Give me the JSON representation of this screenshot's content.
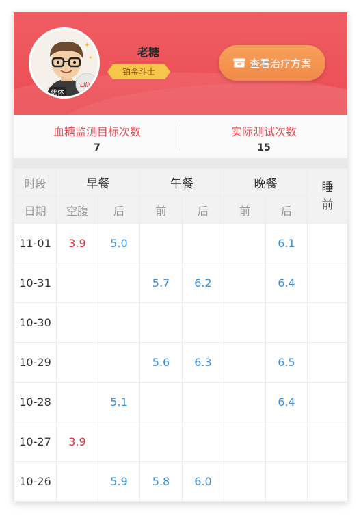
{
  "header": {
    "user_name": "老糖",
    "level": "铂金斗士",
    "avatar_tag": "优体",
    "plan_button_label": "查看治疗方案",
    "colors": {
      "header_bg": "#ec4c53",
      "button_bg": "#f08948",
      "badge_bg": "#f6c64a"
    },
    "icons": {
      "plan_button": "box-icon"
    }
  },
  "stats": {
    "target_label": "血糖监测目标次数",
    "target_value": "7",
    "actual_label": "实际测试次数",
    "actual_value": "15"
  },
  "table": {
    "row_header": {
      "period": "时段",
      "date": "日期"
    },
    "meals": {
      "breakfast": "早餐",
      "lunch": "午餐",
      "dinner": "晚餐",
      "sleep": "睡前"
    },
    "sub": {
      "fasting": "空腹",
      "after": "后",
      "before": "前"
    },
    "rows": [
      {
        "date": "11-01",
        "c1": "3.9",
        "c2": "5.0",
        "c3": "",
        "c4": "",
        "c5": "",
        "c6": "6.1",
        "c7": ""
      },
      {
        "date": "10-31",
        "c1": "",
        "c2": "",
        "c3": "5.7",
        "c4": "6.2",
        "c5": "",
        "c6": "6.4",
        "c7": ""
      },
      {
        "date": "10-30",
        "c1": "",
        "c2": "",
        "c3": "",
        "c4": "",
        "c5": "",
        "c6": "",
        "c7": ""
      },
      {
        "date": "10-29",
        "c1": "",
        "c2": "",
        "c3": "5.6",
        "c4": "6.3",
        "c5": "",
        "c6": "6.5",
        "c7": ""
      },
      {
        "date": "10-28",
        "c1": "",
        "c2": "5.1",
        "c3": "",
        "c4": "",
        "c5": "",
        "c6": "6.4",
        "c7": ""
      },
      {
        "date": "10-27",
        "c1": "3.9",
        "c2": "",
        "c3": "",
        "c4": "",
        "c5": "",
        "c6": "",
        "c7": ""
      },
      {
        "date": "10-26",
        "c1": "",
        "c2": "5.9",
        "c3": "5.8",
        "c4": "6.0",
        "c5": "",
        "c6": "",
        "c7": ""
      }
    ],
    "colors": {
      "low_value": "#d9333a",
      "normal_value": "#3b8fd8"
    }
  }
}
